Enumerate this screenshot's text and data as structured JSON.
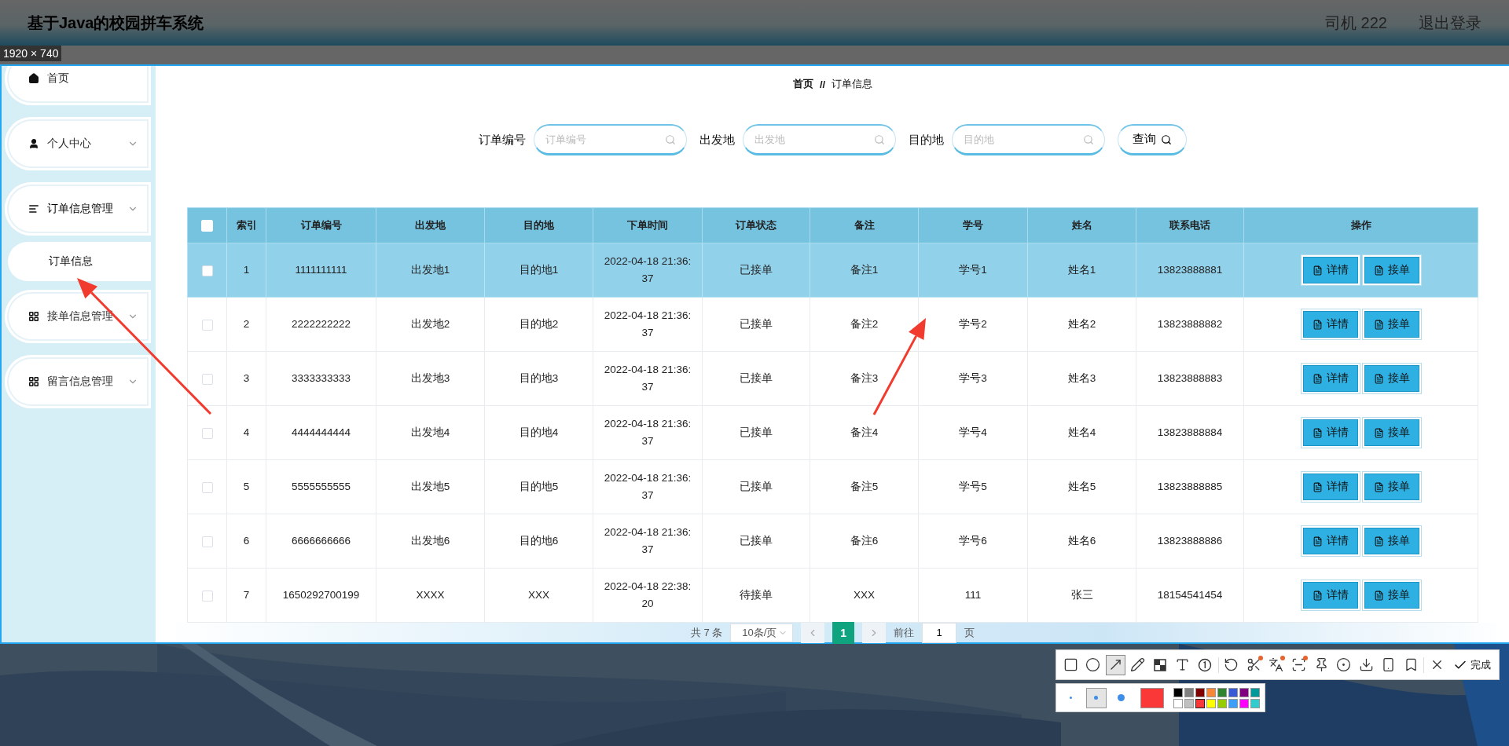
{
  "header": {
    "title": "基于Java的校园拼车系统",
    "user": "司机 222",
    "logout": "退出登录"
  },
  "capture_size": "1920 × 740",
  "sidebar": {
    "items": [
      {
        "label": "首页",
        "kind": "home"
      },
      {
        "label": "个人中心",
        "kind": "user",
        "submenu": true
      },
      {
        "label": "订单信息管理",
        "kind": "list",
        "submenu": true,
        "expanded": true,
        "children": [
          {
            "label": "订单信息",
            "selected": true
          }
        ]
      },
      {
        "label": "接单信息管理",
        "kind": "grid",
        "submenu": true
      },
      {
        "label": "留言信息管理",
        "kind": "grid",
        "submenu": true
      }
    ]
  },
  "breadcrumb": {
    "home": "首页",
    "separator": "//",
    "current": "订单信息"
  },
  "search": {
    "fields": [
      {
        "label": "订单编号",
        "placeholder": "订单编号"
      },
      {
        "label": "出发地",
        "placeholder": "出发地"
      },
      {
        "label": "目的地",
        "placeholder": "目的地"
      }
    ],
    "button": "查询"
  },
  "table": {
    "all_checked": false,
    "columns": [
      "索引",
      "订单编号",
      "出发地",
      "目的地",
      "下单时间",
      "订单状态",
      "备注",
      "学号",
      "姓名",
      "联系电话",
      "操作"
    ],
    "rows": [
      {
        "selected": true,
        "checked": false,
        "cells": [
          "1",
          "1111111111",
          "出发地1",
          "目的地1",
          "2022-04-18 21:36:37",
          "已接单",
          "备注1",
          "学号1",
          "姓名1",
          "13823888881"
        ],
        "actions": [
          "详情",
          "接单"
        ]
      },
      {
        "selected": false,
        "checked": false,
        "cells": [
          "2",
          "2222222222",
          "出发地2",
          "目的地2",
          "2022-04-18 21:36:37",
          "已接单",
          "备注2",
          "学号2",
          "姓名2",
          "13823888882"
        ],
        "actions": [
          "详情",
          "接单"
        ]
      },
      {
        "selected": false,
        "checked": false,
        "cells": [
          "3",
          "3333333333",
          "出发地3",
          "目的地3",
          "2022-04-18 21:36:37",
          "已接单",
          "备注3",
          "学号3",
          "姓名3",
          "13823888883"
        ],
        "actions": [
          "详情",
          "接单"
        ]
      },
      {
        "selected": false,
        "checked": false,
        "cells": [
          "4",
          "4444444444",
          "出发地4",
          "目的地4",
          "2022-04-18 21:36:37",
          "已接单",
          "备注4",
          "学号4",
          "姓名4",
          "13823888884"
        ],
        "actions": [
          "详情",
          "接单"
        ]
      },
      {
        "selected": false,
        "checked": false,
        "cells": [
          "5",
          "5555555555",
          "出发地5",
          "目的地5",
          "2022-04-18 21:36:37",
          "已接单",
          "备注5",
          "学号5",
          "姓名5",
          "13823888885"
        ],
        "actions": [
          "详情",
          "接单"
        ]
      },
      {
        "selected": false,
        "checked": false,
        "cells": [
          "6",
          "6666666666",
          "出发地6",
          "目的地6",
          "2022-04-18 21:36:37",
          "已接单",
          "备注6",
          "学号6",
          "姓名6",
          "13823888886"
        ],
        "actions": [
          "详情",
          "接单"
        ]
      },
      {
        "selected": false,
        "checked": false,
        "cells": [
          "7",
          "1650292700199",
          "XXXX",
          "XXX",
          "2022-04-18 22:38:20",
          "待接单",
          "XXX",
          "111",
          "张三",
          "18154541454"
        ],
        "actions": [
          "详情",
          "接单"
        ]
      }
    ]
  },
  "pagination": {
    "total": "共 7 条",
    "page_size": "10条/页",
    "pages": [
      {
        "label": "1",
        "selected": true
      }
    ],
    "goto_label": "前往",
    "goto_value": "1",
    "goto_suffix": "页"
  },
  "screenshot_toolbar": {
    "tools": [
      {
        "kind": "rect",
        "selected": false,
        "badge": false
      },
      {
        "kind": "ellipse",
        "selected": false,
        "badge": false
      },
      {
        "kind": "arrow",
        "selected": true,
        "badge": false
      },
      {
        "kind": "pencil",
        "selected": false,
        "badge": false
      },
      {
        "kind": "mosaic",
        "selected": false,
        "badge": false
      },
      {
        "kind": "text",
        "selected": false,
        "badge": false
      },
      {
        "kind": "number",
        "selected": false,
        "badge": false
      },
      {
        "kind": "undo",
        "selected": false,
        "badge": false
      },
      {
        "kind": "scissors",
        "selected": false,
        "badge": true
      },
      {
        "kind": "translate",
        "selected": false,
        "badge": true
      },
      {
        "kind": "scan",
        "selected": false,
        "badge": true
      },
      {
        "kind": "pin",
        "selected": false,
        "badge": false
      },
      {
        "kind": "record",
        "selected": false,
        "badge": false
      },
      {
        "kind": "download",
        "selected": false,
        "badge": false
      },
      {
        "kind": "phone",
        "selected": false,
        "badge": false
      },
      {
        "kind": "bookmark",
        "selected": false,
        "badge": false
      },
      {
        "kind": "close",
        "selected": false,
        "badge": false
      }
    ],
    "done": "完成",
    "sizes": [
      {
        "kind": "small",
        "selected": false
      },
      {
        "kind": "medium",
        "selected": true
      },
      {
        "kind": "large",
        "selected": false
      }
    ],
    "palette": [
      {
        "color": "#000000",
        "selected": false
      },
      {
        "color": "#808080",
        "selected": false
      },
      {
        "color": "#800000",
        "selected": false
      },
      {
        "color": "#f7883a",
        "selected": false
      },
      {
        "color": "#308430",
        "selected": false
      },
      {
        "color": "#385ad3",
        "selected": false
      },
      {
        "color": "#800080",
        "selected": false
      },
      {
        "color": "#009999",
        "selected": false
      },
      {
        "color": "#ffffff",
        "selected": false
      },
      {
        "color": "#c0c0c0",
        "selected": false
      },
      {
        "color": "#fb3838",
        "selected": true
      },
      {
        "color": "#ffff00",
        "selected": false
      },
      {
        "color": "#99cc00",
        "selected": false
      },
      {
        "color": "#3d9ef7",
        "selected": false
      },
      {
        "color": "#ff00ff",
        "selected": false
      },
      {
        "color": "#33cccc",
        "selected": false
      }
    ]
  }
}
